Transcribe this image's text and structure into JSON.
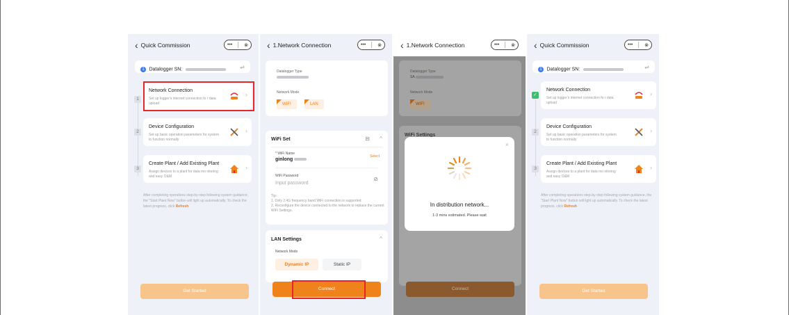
{
  "screens": [
    {
      "title": "Quick Commission",
      "datalogger_label": "Datalogger SN:",
      "steps": [
        {
          "num": "1",
          "title": "Network Connection",
          "desc": "Set up logger's internet connection fo r data upload"
        },
        {
          "num": "2",
          "title": "Device Configuration",
          "desc": "Set up basic operation parameters for system to function normally"
        },
        {
          "num": "3",
          "title": "Create Plant / Add Existing Plant",
          "desc": "Assign devices to a plant for data mo nitoring and easy O&M"
        }
      ],
      "note": "After completing operations step-by-step following system guidance, the \"Start Plant Now\" button will light up automatically. To check the latest progress, click",
      "refresh": "Refresh",
      "button": "Get Started"
    },
    {
      "title": "1.Network Connection",
      "datalogger_type_label": "Datalogger Type",
      "network_mode_label": "Network Mode",
      "modes": [
        "WIFI",
        "LAN"
      ],
      "wifi_set_title": "WiFi Set",
      "wifi_name_label": "* WiFi Name",
      "wifi_name_value": "ginlong",
      "select_label": "Select",
      "wifi_password_label": "WiFi Password",
      "wifi_password_placeholder": "Input password",
      "tips": [
        "Tip:",
        "1. Only 2.4G frequency band WiFi connection is supported",
        "2. Reconfigure the device connected to the network to replace the current WiFi Settings."
      ],
      "lan_title": "LAN Settings",
      "lan_mode_label": "Network Mode",
      "lan_modes": [
        "Dynamic IP",
        "Static IP"
      ],
      "button": "Connect"
    },
    {
      "title": "1.Network Connection",
      "datalogger_type_label": "Datalogger Type",
      "datalogger_type_value": "SA",
      "network_mode_label": "Network Mode",
      "mode": "WIFI",
      "wifi_settings_title": "WiFi Settings",
      "modal_title": "In distribution network...",
      "modal_sub": "1-3 mins estimated. Please wait",
      "button": "Connect"
    },
    {
      "title": "Quick Commission",
      "datalogger_label": "Datalogger SN:",
      "steps": [
        {
          "num": "✓",
          "title": "Network Connection",
          "desc": "Set up logger's internet connection fo r data upload"
        },
        {
          "num": "2",
          "title": "Device Configuration",
          "desc": "Set up basic operation parameters for system to function normally"
        },
        {
          "num": "3",
          "title": "Create Plant / Add Existing Plant",
          "desc": "Assign devices to a plant for data mo nitoring and easy O&M"
        }
      ],
      "note": "After completing operations step-by-step following system guidance, the \"Start Plant Now\" button will light up automatically. To check the latest progress, click",
      "refresh": "Refresh",
      "button": "Get Started"
    }
  ],
  "icons": {
    "back": "chevron-left-icon",
    "more": "more-dots-icon",
    "close": "close-circle-icon",
    "swap": "swap-icon",
    "network": "router-icon",
    "config": "tools-icon",
    "plant": "house-icon",
    "eye": "eye-off-icon",
    "collapse": "chevron-up-icon",
    "loading": "loading-spinner-icon"
  },
  "colors": {
    "accent": "#f0821c",
    "accent_pale": "#f7c48b",
    "highlight": "#e6252a",
    "done": "#3cbf6a",
    "badge": "#3d7bf2"
  }
}
